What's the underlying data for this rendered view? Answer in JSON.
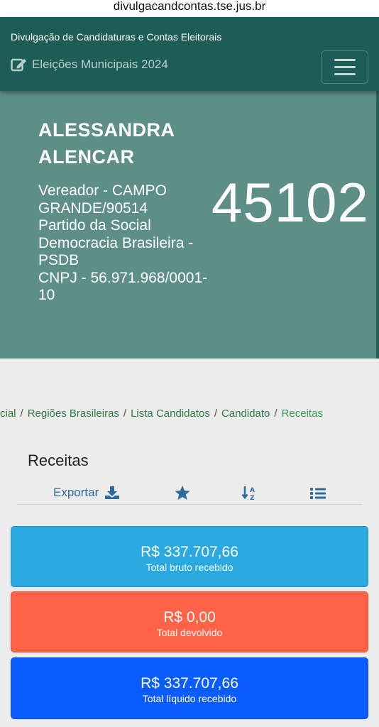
{
  "browser": {
    "url": "divulgacandcontas.tse.jus.br"
  },
  "header": {
    "site_title": "Divulgação de Candidaturas e Contas Eleitorais",
    "election_title": "Eleições Municipais 2024",
    "menu_icon": "hamburger-icon",
    "edit_icon": "edit-square-icon"
  },
  "candidate": {
    "name": "ALESSANDRA ALENCAR",
    "office": "Vereador - CAMPO GRANDE/90514",
    "party": "Partido da Social Democracia Brasileira - PSDB",
    "cnpj": "CNPJ - 56.971.968/0001-10",
    "number": "45102"
  },
  "breadcrumb": {
    "items": [
      "cial",
      "Regiões Brasileiras",
      "Lista Candidatos",
      "Candidato"
    ],
    "current": "Receitas",
    "separator": "/"
  },
  "section": {
    "title": "Receitas",
    "toolbar": {
      "export_label": "Exportar",
      "export_icon": "download-icon",
      "favorite_icon": "star-icon",
      "sort_icon": "sort-alpha-down-icon",
      "list_icon": "list-icon"
    }
  },
  "totals": {
    "bruto": {
      "amount": "R$ 337.707,66",
      "label": "Total bruto recebido",
      "color": "#2aaae1"
    },
    "devolvido": {
      "amount": "R$ 0,00",
      "label": "Total devolvido",
      "color": "#ff6347"
    },
    "liquido": {
      "amount": "R$ 337.707,66",
      "label": "Total líquido recebido",
      "color": "#0a5cff"
    }
  },
  "colors": {
    "header": "#1e5c58",
    "hero": "#5d8f87",
    "link_green": "#2e7a48",
    "toolbar_blue": "#2d6a9f"
  }
}
